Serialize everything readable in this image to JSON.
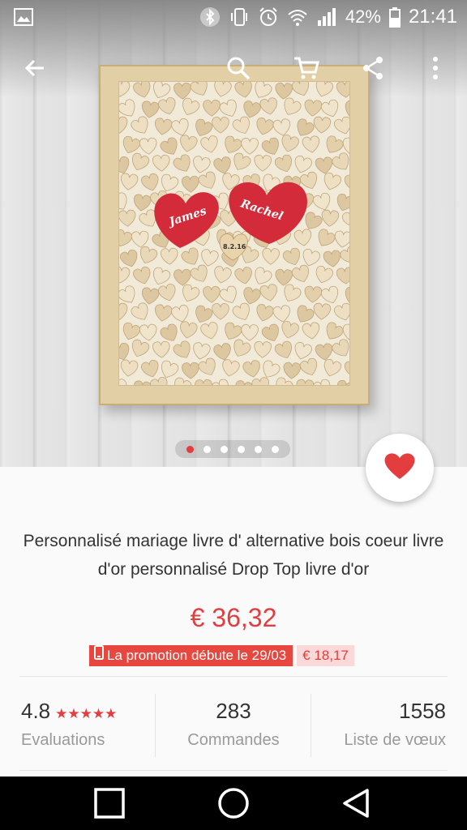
{
  "status_bar": {
    "battery": "42%",
    "time": "21:41",
    "icons": [
      "image-icon",
      "bluetooth-icon",
      "vibrate-icon",
      "alarm-icon",
      "wifi-icon",
      "signal-icon",
      "battery-icon"
    ]
  },
  "toolbar": {
    "icons": [
      "back-arrow-icon",
      "search-icon",
      "cart-icon",
      "share-icon",
      "more-vert-icon"
    ]
  },
  "gallery": {
    "image_count": 6,
    "active_index": 0,
    "image_text": {
      "name_left": "James",
      "name_right": "Rachel",
      "date": "8.2.16"
    }
  },
  "product": {
    "title": "Personnalisé mariage livre d' alternative bois coeur livre d'or personnalisé Drop Top livre d'or",
    "price": "€ 36,32",
    "promo_text": "La promotion débute le 29/03",
    "promo_price": "€ 18,17"
  },
  "stats": {
    "rating": "4.8",
    "stars": "★★★★★",
    "rating_label": "Evaluations",
    "orders": "283",
    "orders_label": "Commandes",
    "wishlist": "1558",
    "wishlist_label": "Liste de vœux"
  },
  "colors": {
    "accent": "#e43d40",
    "promo_bg": "#e8473f",
    "promo_price_bg": "#fbd9d9",
    "navbar": "#000000"
  }
}
